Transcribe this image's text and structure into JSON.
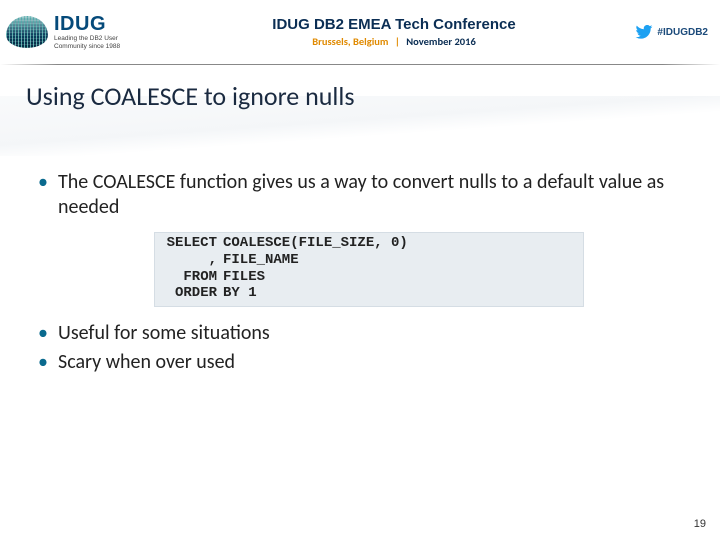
{
  "header": {
    "brand_name": "IDUG",
    "brand_tag_1": "Leading the DB2 User",
    "brand_tag_2": "Community since 1988",
    "conf_title": "IDUG DB2 EMEA Tech Conference",
    "conf_location": "Brussels, Belgium",
    "conf_separator": "|",
    "conf_date": "November 2016",
    "hashtag": "#IDUGDB2"
  },
  "slide_title": "Using COALESCE to ignore nulls",
  "bullets": {
    "intro": "The COALESCE function gives us a way to convert nulls to a default value as needed",
    "useful": "Useful for some situations",
    "scary": "Scary when over used"
  },
  "code": {
    "lines": [
      {
        "kw": "SELECT",
        "rest": "COALESCE(FILE_SIZE, 0)"
      },
      {
        "kw": ",",
        "rest": "FILE_NAME"
      },
      {
        "kw": "FROM",
        "rest": "FILES"
      },
      {
        "kw": "ORDER",
        "rest": "BY 1"
      }
    ]
  },
  "page_number": "19"
}
